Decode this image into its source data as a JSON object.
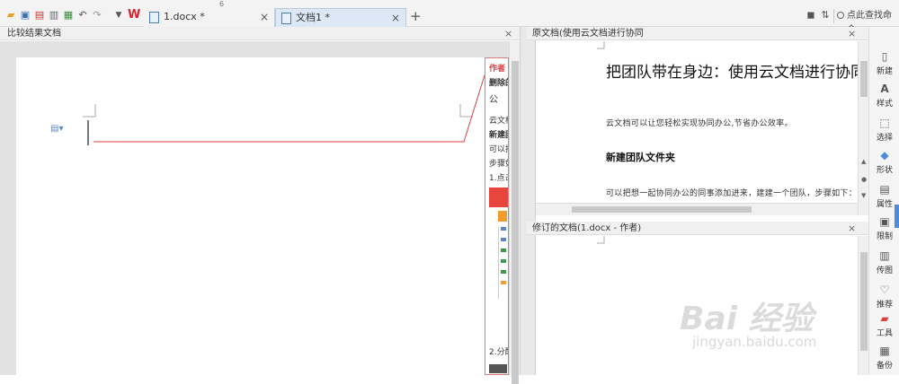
{
  "toolbar": {
    "tabs": [
      {
        "label": "1.docx *",
        "close": "×"
      },
      {
        "label": "文档1 *",
        "close": "×"
      }
    ],
    "add_tab": "+",
    "ruler_mark": "6",
    "search_label": "点此查找命令"
  },
  "left_pane": {
    "title": "比较结果文档",
    "close": "×",
    "balloon_lines": [
      "作者",
      "删除的",
      "公",
      "云文档",
      "新建团",
      "可以把",
      "步骤如",
      "1.点击",
      "2.分配"
    ]
  },
  "original_pane": {
    "title": "原文档(使用云文档进行协同",
    "close": "×",
    "doc_title": "把团队带在身边：使用云文档进行协同",
    "para1": "云文档可以让您轻松实现协同办公,节省办公效率。",
    "heading": "新建团队文件夹",
    "para2": "可以把想一起协同办公的同事添加进来，建建一个团队，步骤如下："
  },
  "revised_pane": {
    "title": "修订的文档(1.docx - 作者)",
    "close": "×"
  },
  "side_panel": {
    "items": [
      {
        "label": "新建",
        "icon": "new-doc-icon"
      },
      {
        "label": "样式",
        "icon": "style-icon"
      },
      {
        "label": "选择",
        "icon": "select-icon"
      },
      {
        "label": "形状",
        "icon": "shape-icon"
      },
      {
        "label": "属性",
        "icon": "properties-icon"
      },
      {
        "label": "限制",
        "icon": "restrict-icon"
      },
      {
        "label": "传图",
        "icon": "upload-image-icon"
      },
      {
        "label": "推荐",
        "icon": "recommend-icon"
      },
      {
        "label": "工具",
        "icon": "toolbox-icon"
      },
      {
        "label": "备份",
        "icon": "backup-icon"
      }
    ]
  },
  "watermark": {
    "main": "Bai 经验",
    "sub": "jingyan.baidu.com"
  },
  "colors": {
    "accent": "#4e8ce0",
    "revision_red": "#d94040",
    "wps_red": "#d9232d"
  }
}
